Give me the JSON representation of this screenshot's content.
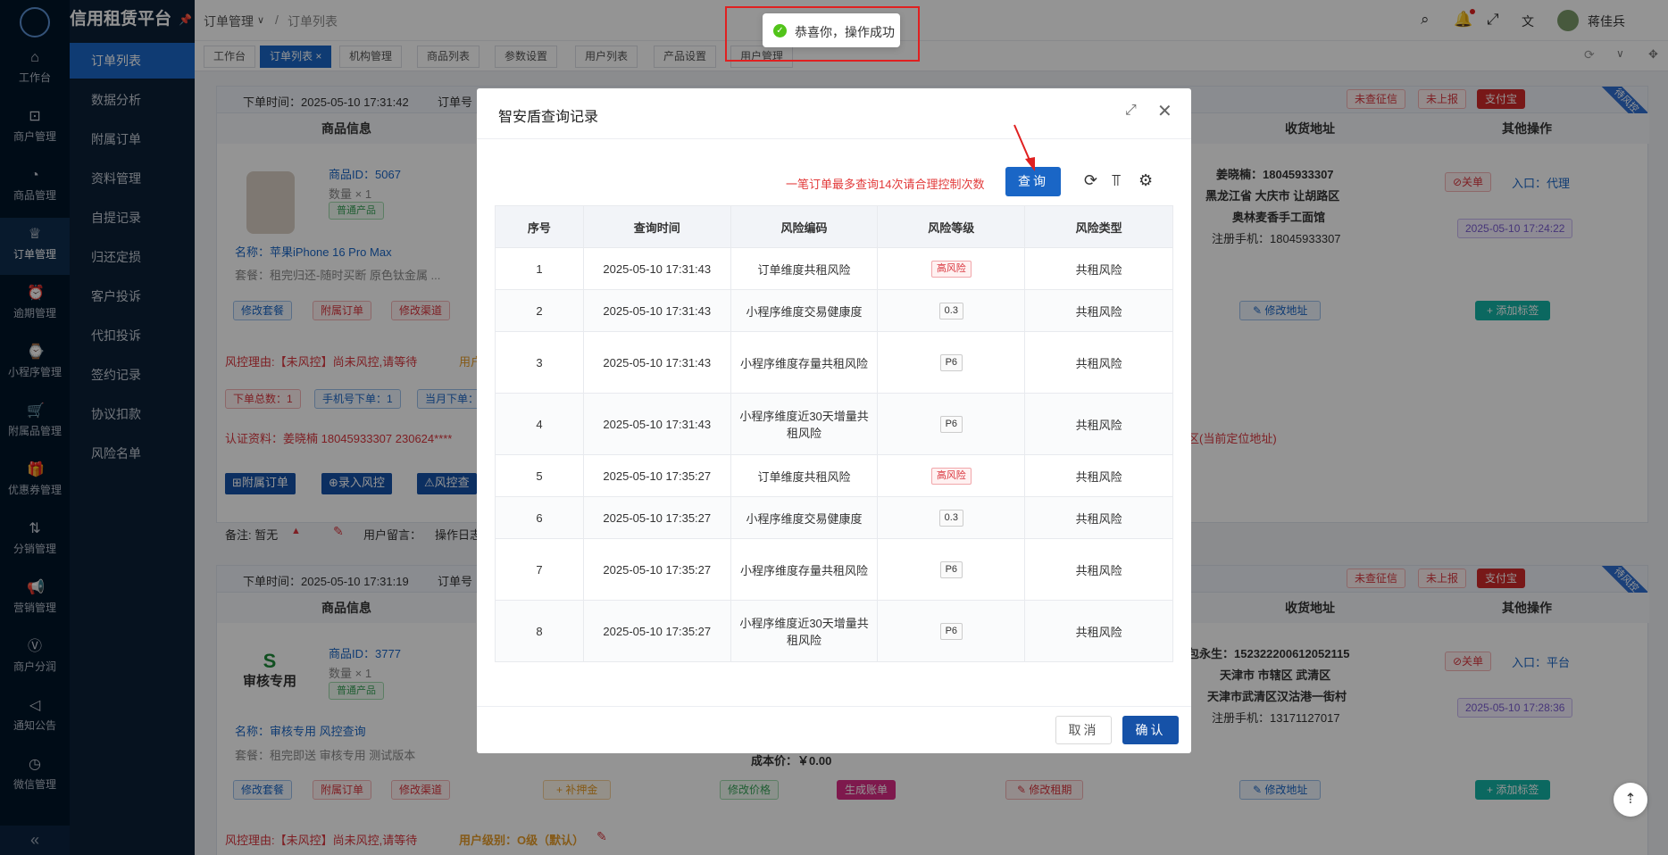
{
  "app": {
    "title": "信用租赁平台",
    "user": "蒋佳兵"
  },
  "rail": [
    {
      "label": "工作台",
      "icon": "home-icon"
    },
    {
      "label": "商户管理",
      "icon": "bag-icon"
    },
    {
      "label": "商品管理",
      "icon": "apple-icon"
    },
    {
      "label": "订单管理",
      "icon": "trophy-icon"
    },
    {
      "label": "逾期管理",
      "icon": "alarm-icon"
    },
    {
      "label": "小程序管理",
      "icon": "watch-icon"
    },
    {
      "label": "附属品管理",
      "icon": "cart-icon"
    },
    {
      "label": "优惠券管理",
      "icon": "gift-icon"
    },
    {
      "label": "分销管理",
      "icon": "share-icon"
    },
    {
      "label": "营销管理",
      "icon": "megaphone-icon"
    },
    {
      "label": "商户分润",
      "icon": "coin-icon"
    },
    {
      "label": "通知公告",
      "icon": "notice-icon"
    },
    {
      "label": "微信管理",
      "icon": "wechat-icon"
    }
  ],
  "submenu": [
    "订单列表",
    "数据分析",
    "附属订单",
    "资料管理",
    "自提记录",
    "归还定损",
    "客户投诉",
    "代扣投诉",
    "签约记录",
    "协议扣款",
    "风险名单"
  ],
  "breadcrumb": {
    "parent": "订单管理",
    "current": "订单列表"
  },
  "tabs": [
    "工作台",
    "订单列表",
    "机构管理",
    "商品列表",
    "参数设置",
    "用户列表",
    "产品设置",
    "用户管理"
  ],
  "toast": {
    "message": "恭喜你，操作成功"
  },
  "orders": [
    {
      "order_time": "下单时间：2025-05-10 17:31:42",
      "order_no_label": "订单号",
      "tags": [
        "未查征信",
        "未上报",
        "支付宝"
      ],
      "corner": "待风控",
      "headers": {
        "goods": "商品信息",
        "address": "收货地址",
        "ops": "其他操作"
      },
      "goods_id": "商品ID：5067",
      "qty": "数量 × 1",
      "product_type": "普通产品",
      "name": "名称：苹果iPhone 16 Pro Max",
      "package": "套餐：租完归还-随时买断 原色钛金属 ...",
      "buttons": [
        "修改套餐",
        "附属订单",
        "修改渠道"
      ],
      "addr_name": "姜晓楠：18045933307",
      "addr_line1": "黑龙江省 大庆市 让胡路区",
      "addr_line2": "奥林麦香手工面馆",
      "addr_phone": "注册手机：18045933307",
      "close_btn": "⊘关单",
      "entry": "入口：代理",
      "date_tag": "2025-05-10 17:24:22",
      "addr_btn": "修改地址",
      "label_btn": "+ 添加标签",
      "risk_reason": "风控理由:【未风控】尚未风控,请等待",
      "user_level_cut": "用户",
      "counters": [
        "下单总数：1",
        "手机号下单：1",
        "当月下单："
      ],
      "cert": "认证资料：姜晓楠 18045933307 230624****",
      "location": "区(当前定位地址)",
      "actions": [
        "⊞附属订单",
        "⊕录入风控",
        "⚠风控查"
      ],
      "remark": "备注: 暂无",
      "user_msg": "用户留言：",
      "op_log": "操作日志"
    },
    {
      "order_time": "下单时间：2025-05-10 17:31:19",
      "order_no_label": "订单号",
      "tags": [
        "未查征信",
        "未上报",
        "支付宝"
      ],
      "corner": "待风控",
      "headers": {
        "goods": "商品信息",
        "address": "收货地址",
        "ops": "其他操作"
      },
      "goods_id": "商品ID：3777",
      "qty": "数量 × 1",
      "product_type": "普通产品",
      "logo_text": "审核专用",
      "name": "名称：审核专用 风控查询",
      "package": "套餐：租完即送 审核专用 测试版本",
      "buttons": [
        "修改套餐",
        "附属订单",
        "修改渠道"
      ],
      "mid_buttons": [
        "+ 补押金",
        "修改价格",
        "生成账单",
        "修改租期"
      ],
      "cost": "成本价：￥0.00",
      "addr_name": "包永生：152322200612052115",
      "addr_line1": "天津市 市辖区 武清区",
      "addr_line2": "天津市武清区汉沽港一街村",
      "addr_phone": "注册手机：13171127017",
      "close_btn": "⊘关单",
      "entry": "入口：平台",
      "date_tag": "2025-05-10 17:28:36",
      "addr_btn": "修改地址",
      "label_btn": "+ 添加标签",
      "risk_reason": "风控理由:【未风控】尚未风控,请等待",
      "user_level": "用户级别：O级（默认）"
    }
  ],
  "dialog": {
    "title": "智安盾查询记录",
    "hint": "一笔订单最多查询14次请合理控制次数",
    "query_btn": "查询",
    "columns": [
      "序号",
      "查询时间",
      "风险编码",
      "风险等级",
      "风险类型"
    ],
    "rows": [
      {
        "no": "1",
        "time": "2025-05-10 17:31:43",
        "code": "订单维度共租风险",
        "level": "高风险",
        "type": "共租风险"
      },
      {
        "no": "2",
        "time": "2025-05-10 17:31:43",
        "code": "小程序维度交易健康度",
        "level": "0.3",
        "type": "共租风险"
      },
      {
        "no": "3",
        "time": "2025-05-10 17:31:43",
        "code": "小程序维度存量共租风险",
        "level": "P6",
        "type": "共租风险"
      },
      {
        "no": "4",
        "time": "2025-05-10 17:31:43",
        "code": "小程序维度近30天增量共租风险",
        "level": "P6",
        "type": "共租风险"
      },
      {
        "no": "5",
        "time": "2025-05-10 17:35:27",
        "code": "订单维度共租风险",
        "level": "高风险",
        "type": "共租风险"
      },
      {
        "no": "6",
        "time": "2025-05-10 17:35:27",
        "code": "小程序维度交易健康度",
        "level": "0.3",
        "type": "共租风险"
      },
      {
        "no": "7",
        "time": "2025-05-10 17:35:27",
        "code": "小程序维度存量共租风险",
        "level": "P6",
        "type": "共租风险"
      },
      {
        "no": "8",
        "time": "2025-05-10 17:35:27",
        "code": "小程序维度近30天增量共租风险",
        "level": "P6",
        "type": "共租风险"
      }
    ],
    "cancel": "取消",
    "confirm": "确认"
  }
}
